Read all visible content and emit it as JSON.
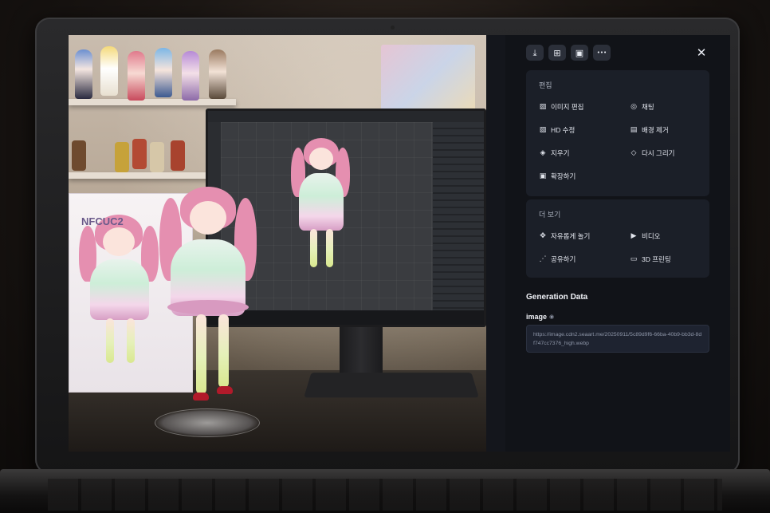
{
  "toolbar": {
    "icons": [
      "download-icon",
      "plus-square-icon",
      "save-icon",
      "more-icon"
    ],
    "glyphs": [
      "⤓",
      "⊞",
      "▣",
      "•••"
    ],
    "close_glyph": "✕"
  },
  "edit_section": {
    "title": "편집",
    "items": [
      {
        "label": "이미지 편집",
        "icon": "image-edit-icon",
        "glyph": "▨"
      },
      {
        "label": "채팅",
        "icon": "chat-icon",
        "glyph": "◎"
      },
      {
        "label": "HD 수정",
        "icon": "hd-icon",
        "glyph": "▧"
      },
      {
        "label": "배경 제거",
        "icon": "background-remove-icon",
        "glyph": "▤"
      },
      {
        "label": "지우기",
        "icon": "eraser-icon",
        "glyph": "◈"
      },
      {
        "label": "다시 그리기",
        "icon": "redraw-icon",
        "glyph": "◇"
      },
      {
        "label": "확장하기",
        "icon": "expand-icon",
        "glyph": "▣"
      }
    ]
  },
  "more_section": {
    "title": "더 보기",
    "items": [
      {
        "label": "자유롭게 놀기",
        "icon": "sparkle-icon",
        "glyph": "✥"
      },
      {
        "label": "비디오",
        "icon": "video-icon",
        "glyph": "▶"
      },
      {
        "label": "공유하기",
        "icon": "share-icon",
        "glyph": "⋰"
      },
      {
        "label": "3D 프린팅",
        "icon": "printer-3d-icon",
        "glyph": "▭"
      }
    ]
  },
  "generation": {
    "title": "Generation Data",
    "image_label": "image",
    "eye_icon": "◉",
    "image_url": "https://image.cdn2.seaart.me/20250911/5c89d9f6-66ba-40b9-bb3d-8df747cc7376_high.webp"
  },
  "photo": {
    "box_label": "NFCUC2"
  },
  "colors": {
    "panel_bg": "#111318",
    "card_bg": "#1b1f28",
    "text": "#e3e6ee",
    "muted": "#aab0bd"
  }
}
